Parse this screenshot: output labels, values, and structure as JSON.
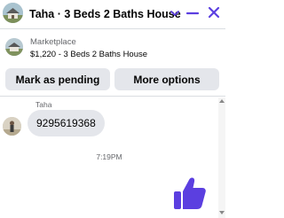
{
  "header": {
    "title": "Taha · 3 Beds 2 Baths House",
    "accent_color": "#5b3fe0",
    "icons": [
      "house-avatar",
      "chevron-down-icon",
      "minimize-icon",
      "close-icon"
    ]
  },
  "listing": {
    "label": "Marketplace",
    "description": "$1,220 - 3 Beds 2 Baths House"
  },
  "actions": {
    "mark_pending": "Mark as pending",
    "more_options": "More options"
  },
  "conversation": {
    "sender_name": "Taha",
    "messages": [
      {
        "from": "Taha",
        "text": "9295619368"
      }
    ],
    "timestamp": "7:19PM"
  },
  "composer": {
    "like_icon": "thumbs-up-icon",
    "like_color": "#5b3fe0"
  }
}
